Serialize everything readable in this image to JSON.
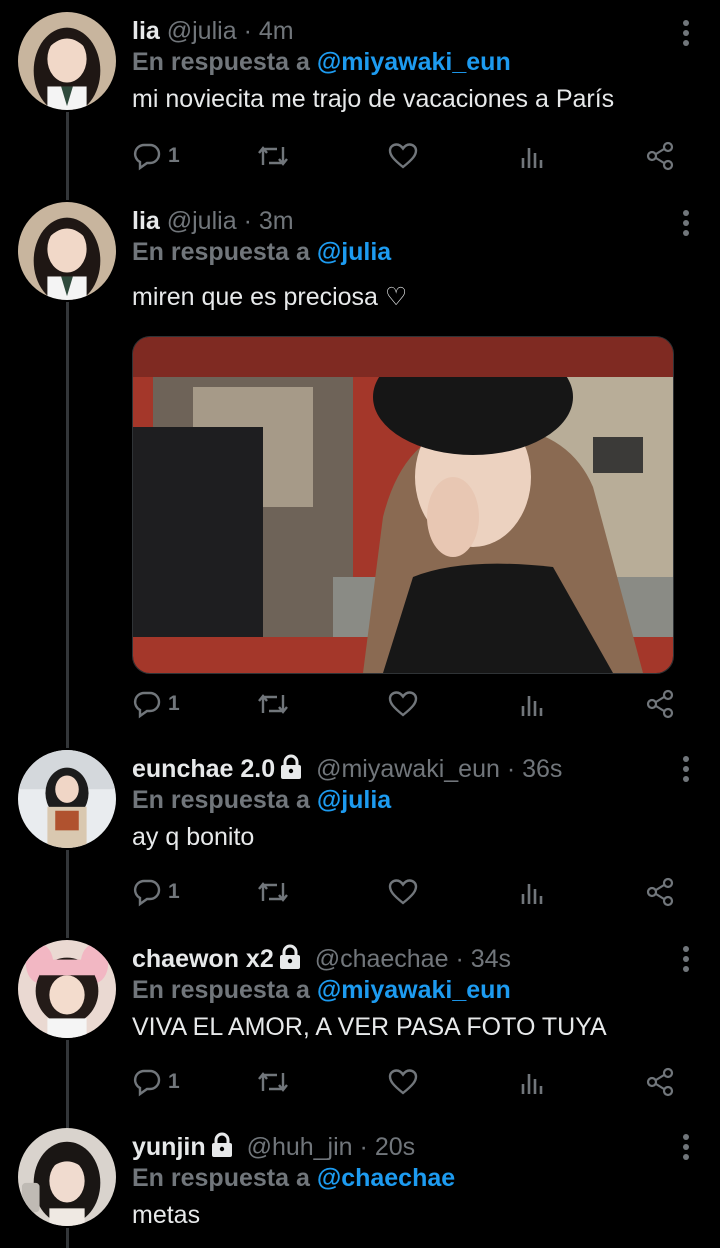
{
  "tweets": [
    {
      "name": "lia",
      "handle": "@julia",
      "time": "4m",
      "reply_prefix": "En respuesta a",
      "reply_to": "@miyawaki_eun",
      "text": "mi noviecita me trajo de vacaciones a París",
      "reply_count": "1",
      "locked": false
    },
    {
      "name": "lia",
      "handle": "@julia",
      "time": "3m",
      "reply_prefix": "En respuesta a",
      "reply_to": "@julia",
      "text": "miren que es preciosa ♡",
      "reply_count": "1",
      "locked": false,
      "has_media": true
    },
    {
      "name": "eunchae 2.0",
      "handle": "@miyawaki_eun",
      "time": "36s",
      "reply_prefix": "En respuesta a",
      "reply_to": "@julia",
      "text": "ay q bonito",
      "reply_count": "1",
      "locked": true
    },
    {
      "name": "chaewon x2",
      "handle": "@chaechae",
      "time": "34s",
      "reply_prefix": "En respuesta a",
      "reply_to": "@miyawaki_eun",
      "text": "VIVA EL AMOR, A VER PASA FOTO TUYA",
      "reply_count": "1",
      "locked": true
    },
    {
      "name": "yunjin",
      "handle": "@huh_jin",
      "time": "20s",
      "reply_prefix": "En respuesta a",
      "reply_to": "@chaechae",
      "text": "metas",
      "locked": true
    }
  ],
  "separator": "·",
  "icons": {
    "reply": "reply-icon",
    "retweet": "retweet-icon",
    "like": "like-icon",
    "views": "views-icon",
    "share": "share-icon",
    "menu": "more-vertical-icon",
    "lock": "lock-icon"
  },
  "colors": {
    "background": "#000000",
    "text": "#e7e9ea",
    "muted": "#71767b",
    "link": "#1d9bf0"
  }
}
